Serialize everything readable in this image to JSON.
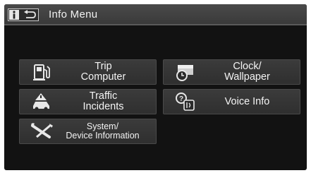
{
  "header": {
    "title": "Info Menu"
  },
  "menu": {
    "trip_computer": {
      "line1": "Trip",
      "line2": "Computer",
      "icon": "fuel-pump-icon"
    },
    "clock_wallpaper": {
      "line1": "Clock/",
      "line2": "Wallpaper",
      "icon": "clock-wallpaper-icon"
    },
    "traffic_incidents": {
      "line1": "Traffic",
      "line2": "Incidents",
      "icon": "traffic-car-icon"
    },
    "voice_info": {
      "label": "Voice Info",
      "icon": "voice-help-icon"
    },
    "system_device": {
      "line1": "System/",
      "line2": "Device Information",
      "icon": "wrench-screwdriver-icon"
    }
  },
  "colors": {
    "background": "#121212",
    "button": "#353535",
    "text": "#f4f4f4"
  }
}
